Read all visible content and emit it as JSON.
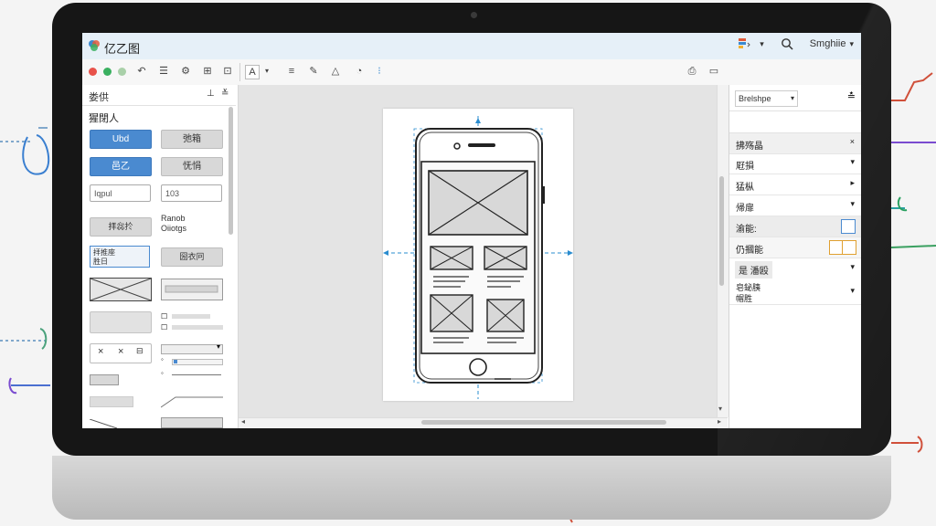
{
  "app": {
    "title": "亿乙图"
  },
  "titlebar": {
    "user_menu_label": "Smghiie"
  },
  "left_panel": {
    "header": "娄供",
    "section": "猩閉人",
    "buttons": {
      "blue1": "Ubd",
      "gray1": "弛箱",
      "blue2": "邑乙",
      "gray2": "怃悁"
    },
    "inputs": {
      "input1": "Iqpul",
      "input2": "103"
    },
    "items": {
      "gray_btn": "拝惢扵",
      "radio_text_line1": "Ranob",
      "radio_text_line2": "Oiiotgs",
      "textarea_line1": "拝推座",
      "textarea_line2": "胜日",
      "dropdown": "圀衣冋",
      "x_close_a": "×",
      "x_close_b": "×",
      "dropdown_arrow": "▾"
    }
  },
  "right_panel": {
    "style_dropdown": "Brelshpe",
    "section_title": "拂殇晶",
    "rows": [
      {
        "label": "屘損",
        "control": "▾"
      },
      {
        "label": "猛枞",
        "control": "▸"
      },
      {
        "label": "帰扉",
        "control": "▾"
      }
    ],
    "fill_label": "渝能:",
    "line_label": "仍摑能",
    "shadow_label": "是 潘殴",
    "shadow_control": "▾",
    "other_label": "皂鉍胰",
    "other_label2": "帽胜"
  },
  "colors": {
    "accent": "#4a8ad0",
    "guide": "#2a8ccf",
    "titlebar_bg": "#e6f0f8"
  },
  "icons": [
    "logo-icon",
    "format-icon",
    "search-icon",
    "undo-icon",
    "lines-icon",
    "shape-icon",
    "pen-icon",
    "image-icon",
    "align-icon",
    "export-icon",
    "close-icon"
  ]
}
